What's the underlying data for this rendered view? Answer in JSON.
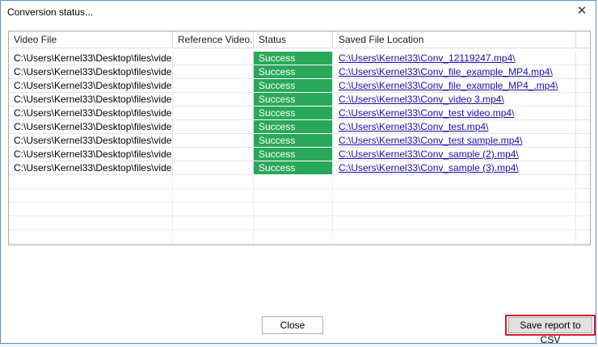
{
  "window": {
    "title": "Conversion status..."
  },
  "grid": {
    "columns": [
      "Video File",
      "Reference Video...",
      "Status",
      "Saved File Location"
    ],
    "rows": [
      {
        "video_file": "C:\\Users\\Kernel33\\Desktop\\files\\vide...",
        "reference": "",
        "status": "Success",
        "location": "C:\\Users\\Kernel33\\Conv_12119247.mp4\\"
      },
      {
        "video_file": "C:\\Users\\Kernel33\\Desktop\\files\\vide...",
        "reference": "",
        "status": "Success",
        "location": "C:\\Users\\Kernel33\\Conv_file_example_MP4.mp4\\"
      },
      {
        "video_file": "C:\\Users\\Kernel33\\Desktop\\files\\vide...",
        "reference": "",
        "status": "Success",
        "location": "C:\\Users\\Kernel33\\Conv_file_example_MP4_.mp4\\"
      },
      {
        "video_file": "C:\\Users\\Kernel33\\Desktop\\files\\vide...",
        "reference": "",
        "status": "Success",
        "location": "C:\\Users\\Kernel33\\Conv_video 3.mp4\\"
      },
      {
        "video_file": "C:\\Users\\Kernel33\\Desktop\\files\\vide...",
        "reference": "",
        "status": "Success",
        "location": "C:\\Users\\Kernel33\\Conv_test video.mp4\\"
      },
      {
        "video_file": "C:\\Users\\Kernel33\\Desktop\\files\\vide...",
        "reference": "",
        "status": "Success",
        "location": "C:\\Users\\Kernel33\\Conv_test.mp4\\"
      },
      {
        "video_file": "C:\\Users\\Kernel33\\Desktop\\files\\vide...",
        "reference": "",
        "status": "Success",
        "location": "C:\\Users\\Kernel33\\Conv_test sample.mp4\\"
      },
      {
        "video_file": "C:\\Users\\Kernel33\\Desktop\\files\\vide...",
        "reference": "",
        "status": "Success",
        "location": "C:\\Users\\Kernel33\\Conv_sample (2).mp4\\"
      },
      {
        "video_file": "C:\\Users\\Kernel33\\Desktop\\files\\vide...",
        "reference": "",
        "status": "Success",
        "location": "C:\\Users\\Kernel33\\Conv_sample (3).mp4\\"
      }
    ]
  },
  "buttons": {
    "close_label": "Close",
    "save_csv_label": "Save report to CSV"
  },
  "icons": {
    "close": "close-icon"
  },
  "colors": {
    "success_bg": "#2aa85a",
    "link": "#1a0dab",
    "highlight_outline": "#d0202a"
  }
}
